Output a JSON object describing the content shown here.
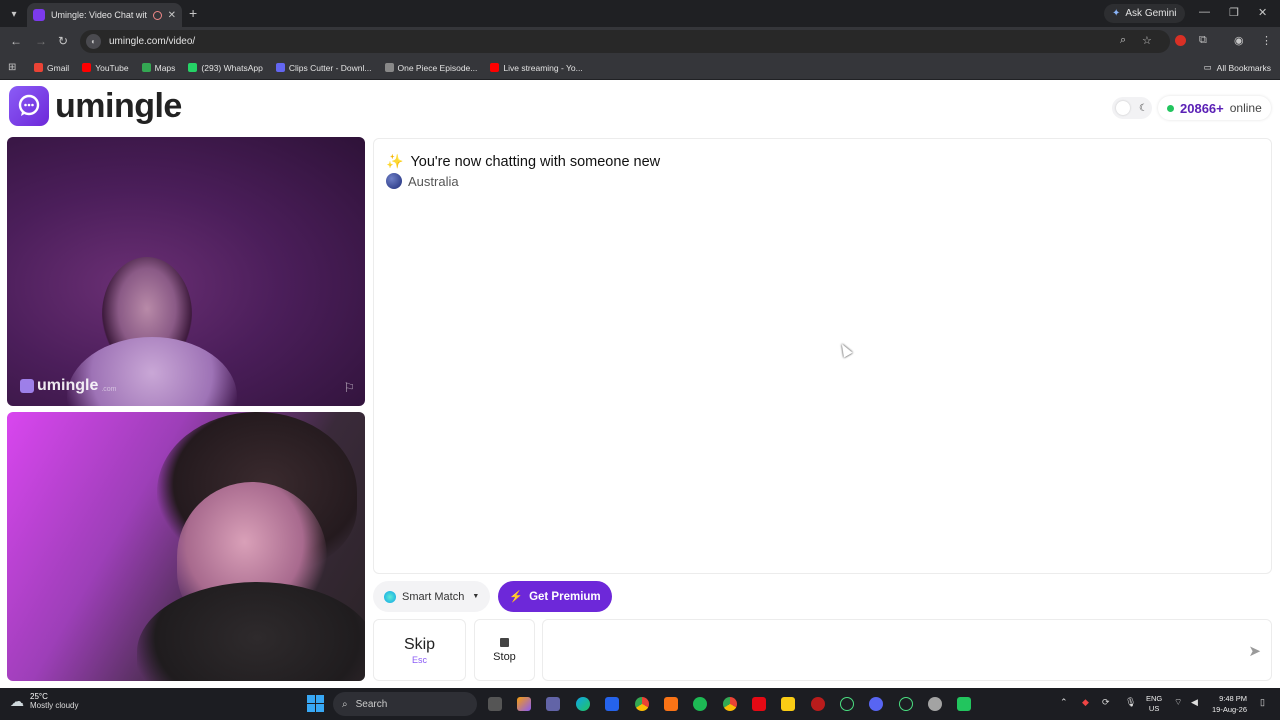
{
  "browser": {
    "tab_title": "Umingle: Video Chat with St",
    "url": "umingle.com/video/",
    "ask_gemini": "Ask Gemini",
    "bookmarks": [
      {
        "label": "Gmail",
        "color": "#ea4335"
      },
      {
        "label": "YouTube",
        "color": "#ff0000"
      },
      {
        "label": "Maps",
        "color": "#34a853"
      },
      {
        "label": "(293) WhatsApp",
        "color": "#25d366"
      },
      {
        "label": "Clips Cutter - Downl...",
        "color": "#6366f1"
      },
      {
        "label": "One Piece Episode...",
        "color": "#888888"
      },
      {
        "label": "Live streaming - Yo...",
        "color": "#ff0000"
      }
    ],
    "all_bookmarks": "All Bookmarks"
  },
  "page": {
    "logo_text": "umingle",
    "online_count": "20866+",
    "online_label": "online",
    "watermark_text": "umingle",
    "watermark_suffix": ".com",
    "chat": {
      "status": "You're now chatting with someone new",
      "country": "Australia"
    },
    "smart_match": "Smart Match",
    "get_premium": "Get Premium",
    "skip_label": "Skip",
    "skip_key": "Esc",
    "stop_label": "Stop",
    "message_value": ""
  },
  "taskbar": {
    "temperature": "25°C",
    "weather": "Mostly cloudy",
    "search_placeholder": "Search",
    "lang_primary": "ENG",
    "lang_secondary": "US",
    "time": "9:48 PM",
    "date": "19-Aug-26"
  },
  "colors": {
    "brand": "#6d28d9",
    "online_dot": "#22c55e"
  }
}
